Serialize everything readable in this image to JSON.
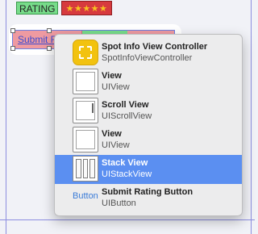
{
  "canvas": {
    "rating_label": "RATING",
    "rating_stars": "★★★★★",
    "submit_button_text": "Submit R"
  },
  "menu": {
    "items": [
      {
        "title": "Spot Info View Controller",
        "subtitle": "SpotInfoViewController",
        "icon": "view-controller-icon"
      },
      {
        "title": "View",
        "subtitle": "UIView",
        "icon": "view-icon"
      },
      {
        "title": "Scroll View",
        "subtitle": "UIScrollView",
        "icon": "scroll-view-icon"
      },
      {
        "title": "View",
        "subtitle": "UIView",
        "icon": "view-icon"
      },
      {
        "title": "Stack View",
        "subtitle": "UIStackView",
        "icon": "stack-view-icon",
        "selected": true
      },
      {
        "title": "Submit Rating Button",
        "subtitle": "UIButton",
        "icon_text": "Button"
      }
    ]
  },
  "colors": {
    "selection": "#5b8ff1",
    "rating_label_bg": "#77dc8a",
    "stars_bg": "#d73a3e",
    "button_bg": "#ee9aa1",
    "guide": "#8d8ee0"
  }
}
